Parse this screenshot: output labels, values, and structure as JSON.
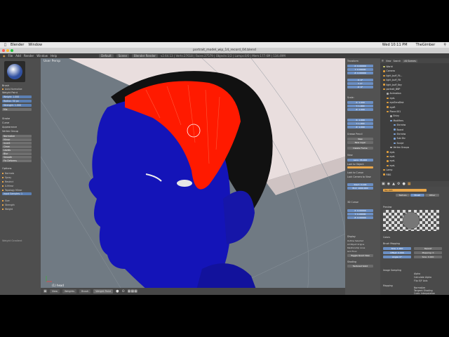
{
  "menubar": {
    "app_name": "Blender",
    "window_menu": "Window",
    "clock": "Wed 10:11 PM",
    "user": "TheGimber"
  },
  "titlebar": {
    "title": "portrait_model_wip_14_record_04.blend"
  },
  "infobar": {
    "menus": [
      "File",
      "Add",
      "Render",
      "Window",
      "Help"
    ],
    "layout": "Default",
    "scene": "Scene",
    "engine": "Blender Render",
    "stats": "v2.64.13 | Verts:27618 | Faces:27579 | Objects:1/2 | Lamps:0/0 | Mem:177.6M | 134.49M"
  },
  "viewport": {
    "label": "User Persp",
    "object_label": "(1) head",
    "header_buttons": [
      "View",
      "Weights",
      "Brush",
      "Weight Paint"
    ]
  },
  "tool_panel": {
    "brush_label": "Brush",
    "auto_normalize": "Auto Normalize",
    "mode": "Weight Paint",
    "fields": [
      "Weight: 1.000",
      "Radius: 50 px",
      "Strength: 1.000"
    ],
    "blend_mode": "Mix",
    "sections": [
      "Stroke",
      "Curve",
      "Appearance",
      "Vertex Group"
    ],
    "vgroup_items": [
      "Normalize",
      "Mirror",
      "Invert",
      "Clean",
      "Levels",
      "Blur",
      "Smooth",
      "Fix Deforms"
    ],
    "options_title": "Options",
    "options": [
      "Normals",
      "Spray",
      "Restrict",
      "X-Mirror",
      "Topology Mirror"
    ],
    "input_samples": "Input Samples: 1",
    "unified": [
      "Size",
      "Strength",
      "Weight"
    ],
    "footer": "Weight Gradient"
  },
  "n_panel": {
    "transform_title": "Transform",
    "location": [
      "X: 0.00000",
      "Y: 0.00000",
      "Z: 0.00000"
    ],
    "rotation": [
      "X: 0°",
      "Y: 0°",
      "Z: 0°"
    ],
    "scale_title": "Scale:",
    "scale": [
      "X: 1.000",
      "Y: 1.000",
      "Z: 1.000"
    ],
    "grease_title": "Grease Pencil",
    "grease_btns": [
      "New",
      "New Layer",
      "Delete Frame"
    ],
    "view_title": "View",
    "lens": "Lens: 35.000",
    "lock_to_object": "Lock to Object:",
    "lock_to_cursor": "Lock to Cursor",
    "lock_camera": "Lock Camera to View",
    "clip_start": "Start: 0.100",
    "clip_end": "End: 1000.000",
    "cursor_title": "3D Cursor",
    "cursor": [
      "X: 0.00000",
      "Y: 0.00000",
      "Z: 0.00000"
    ],
    "display_title": "Display",
    "display_opts": [
      "Outline Selected",
      "All Object Origins",
      "Relationship Lines",
      "Grid Floor",
      "Toggle Quad View"
    ],
    "shading_title": "Shading",
    "matcap": "Textured Solid"
  },
  "outliner": {
    "header_buttons": [
      "View",
      "Search"
    ],
    "scope": "All Scenes",
    "items": [
      {
        "label": "World",
        "indent": 0,
        "color": "#d0d070"
      },
      {
        "label": "Camera",
        "indent": 0,
        "color": "#e6a23c"
      },
      {
        "label": "light_buff_Fil...",
        "indent": 0,
        "color": "#e6a23c"
      },
      {
        "label": "light_buff_Fill",
        "indent": 0,
        "color": "#e6a23c"
      },
      {
        "label": "light_buff_Key",
        "indent": 0,
        "color": "#e6a23c"
      },
      {
        "label": "portrait_BBP",
        "indent": 0,
        "color": "#e6a23c"
      },
      {
        "label": "Animation",
        "indent": 1,
        "color": "#b0b0b0"
      },
      {
        "label": "eyeL",
        "indent": 1,
        "color": "#e6a23c"
      },
      {
        "label": "eyeZeroDisk",
        "indent": 1,
        "color": "#e6a23c"
      },
      {
        "label": "eyeR",
        "indent": 1,
        "color": "#e6a23c"
      },
      {
        "label": "Plane.001",
        "indent": 1,
        "color": "#e6a23c"
      },
      {
        "label": "Entry",
        "indent": 2,
        "color": "#b0b0b0"
      },
      {
        "label": "Modifiers",
        "indent": 2,
        "color": "#7fa7e0"
      },
      {
        "label": "Shrinkw",
        "indent": 3,
        "color": "#7fa7e0"
      },
      {
        "label": "Board",
        "indent": 3,
        "color": "#7fa7e0"
      },
      {
        "label": "Shrinkw",
        "indent": 3,
        "color": "#7fa7e0"
      },
      {
        "label": "Sub Div",
        "indent": 3,
        "color": "#7fa7e0"
      },
      {
        "label": "Sculpt",
        "indent": 3,
        "color": "#7fa7e0"
      },
      {
        "label": "Vertex Groups",
        "indent": 2,
        "color": "#b0b0b0"
      },
      {
        "label": "eyeL",
        "indent": 1,
        "color": "#e6a23c"
      },
      {
        "label": "eyeL",
        "indent": 1,
        "color": "#e6a23c"
      },
      {
        "label": "eyeL",
        "indent": 1,
        "color": "#e6a23c"
      },
      {
        "label": "eyeL",
        "indent": 1,
        "color": "#e6a23c"
      },
      {
        "label": "Lamp",
        "indent": 0,
        "color": "#e6a23c"
      },
      {
        "label": "RBG",
        "indent": 0,
        "color": "#e6a23c"
      }
    ]
  },
  "properties": {
    "texture_name": "Tex.003",
    "tabs": [
      "Texture",
      "Brush",
      "Other"
    ],
    "preview_title": "Preview",
    "colors_title": "Colors",
    "brush_tex_title": "Brush Mapping",
    "fields": [
      "Size: 1.000",
      "Repeat",
      "Offset: 0.000",
      "Mapping: 0",
      "Angle: 0°",
      "Size: 0.000"
    ],
    "image_sampling_title": "Image Sampling",
    "checks": [
      "Alpha",
      "Calculate Alpha",
      "Flip X/Y Axis"
    ],
    "mapping_title": "Mapping",
    "mapping_opts": [
      "Normalize",
      "Tangent Shading",
      "Cubic Interpolation"
    ],
    "accent": "#e8a64a"
  },
  "colors": {
    "skin": "#1414b8",
    "hair_red": "#ff1a00",
    "hair_dark": "#111111",
    "wall": "#e9dede",
    "select_blue": "#6b8fc4"
  }
}
